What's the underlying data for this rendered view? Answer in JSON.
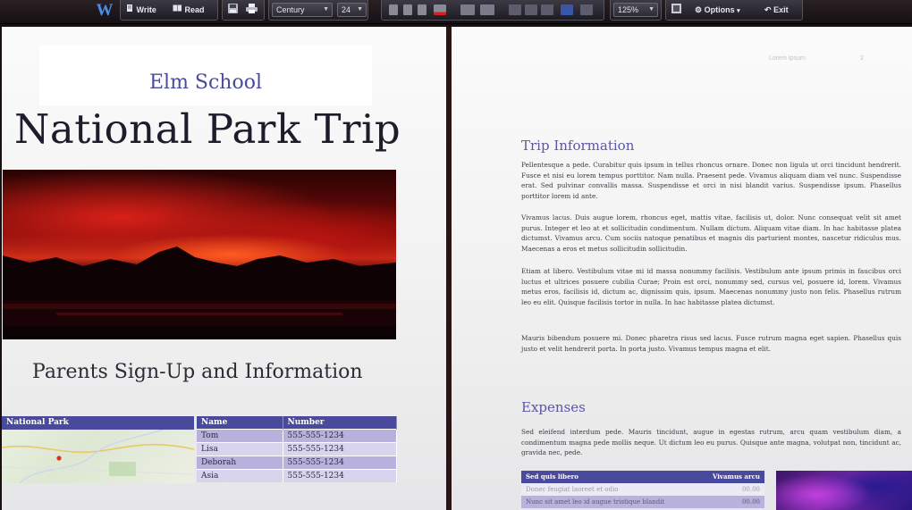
{
  "toolbar": {
    "app_logo": "W",
    "write_label": "Write",
    "read_label": "Read",
    "font_name": "Century",
    "font_size": "24",
    "zoom": "125%",
    "options_label": "Options",
    "exit_label": "Exit",
    "icons": [
      "save-icon",
      "print-icon",
      "bold-icon",
      "italic-icon",
      "underline-icon",
      "text-color-icon",
      "bullets-icon",
      "align-icon",
      "spacing-icon",
      "insert-picture-icon"
    ]
  },
  "left_page": {
    "school": "Elm School",
    "title": "National Park Trip",
    "section_heading": "Parents Sign-Up and Information",
    "map_header": "National Park",
    "contacts": {
      "headers": [
        "Name",
        "Number"
      ],
      "rows": [
        [
          "Tom",
          "555-555-1234"
        ],
        [
          "Lisa",
          "555-555-1234"
        ],
        [
          "Deborah",
          "555-555-1234"
        ],
        [
          "Asia",
          "555-555-1234"
        ]
      ]
    }
  },
  "right_page": {
    "header_text": "Lorem Ipsum",
    "page_number": "2",
    "trip_heading": "Trip Information",
    "trip_paragraphs": [
      "Pellentesque a pede. Curabitur quis ipsum in tellus rhoncus ornare. Donec non ligula ut orci tincidunt hendrerit. Fusce et nisi eu lorem tempus porttitor. Nam nulla. Praesent pede. Vivamus aliquam diam vel nunc. Suspendisse erat. Sed pulvinar convallis massa. Suspendisse et orci in nisi blandit varius. Suspendisse ipsum. Phasellus porttitor lorem id ante.",
      "Vivamus lacus. Duis augue lorem, rhoncus eget, mattis vitae, facilisis ut, dolor. Nunc consequat velit sit amet purus. Integer et leo at et sollicitudin condimentum. Nullam dictum. Aliquam vitae diam. In hac habitasse platea dictumst. Vivamus arcu. Cum sociis natoque penatibus et magnis dis parturient montes, nascetur ridiculus mus. Maecenas a eros et metus sollicitudin sollicitudin.",
      "Etiam at libero. Vestibulum vitae mi id massa nonummy facilisis. Vestibulum ante ipsum primis in faucibus orci luctus et ultrices posuere cubilia Curae; Proin est orci, nonummy sed, cursus vel, posuere id, lorem. Vivamus metus eros, facilisis id, dictum ac, dignissim quis, ipsum. Maecenas nonummy justo non felis. Phasellus rutrum leo eu elit. Quisque facilisis tortor in nulla. In hac habitasse platea dictumst.",
      "Mauris bibendum posuere mi. Donec pharetra risus sed lacus. Fusce rutrum magna eget sapien. Phasellus quis justo et velit hendrerit porta. In porta justo. Vivamus tempus magna et elit."
    ],
    "expenses_heading": "Expenses",
    "expenses_paragraph": "Sed eleifend interdum pede. Mauris tincidunt, augue in egestas rutrum, arcu quam vestibulum diam, a condimentum magna pede mollis neque. Ut dictum leo eu purus. Quisque ante magna, volutpat non, tincidunt ac, gravida nec, pede.",
    "expenses_table": {
      "headers": [
        "Sed quis libero",
        "Vivamus arcu"
      ],
      "rows": [
        [
          "Donec feugiat laoreet et odio",
          "00.00"
        ],
        [
          "Nunc sit amet leo id augue tristique blandit",
          "00.00"
        ]
      ]
    }
  }
}
